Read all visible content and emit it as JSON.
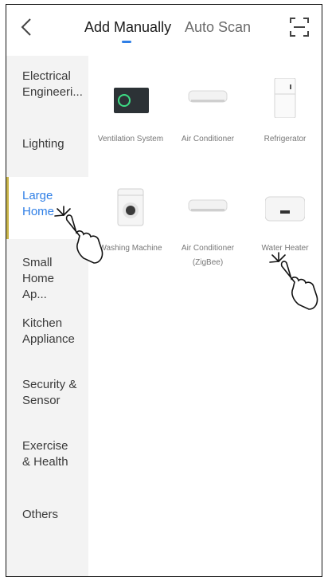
{
  "header": {
    "tabs": [
      {
        "label": "Add Manually",
        "active": true
      },
      {
        "label": "Auto Scan",
        "active": false
      }
    ],
    "back_icon": "chevron-left-icon",
    "scan_icon": "scan-frame-icon",
    "accent_color": "#2f7fe6"
  },
  "sidebar": {
    "items": [
      {
        "label": "Electrical Engineeri..."
      },
      {
        "label": "Lighting"
      },
      {
        "label": "Large Home",
        "active": true
      },
      {
        "label": "Small Home Ap..."
      },
      {
        "label": "Kitchen Appliance"
      },
      {
        "label": "Security & Sensor"
      },
      {
        "label": "Exercise & Health"
      },
      {
        "label": "Others"
      }
    ]
  },
  "devices": [
    {
      "name": "Ventilation System",
      "icon": "ventilation-icon"
    },
    {
      "name": "Air Conditioner",
      "icon": "air-conditioner-icon"
    },
    {
      "name": "Refrigerator",
      "icon": "refrigerator-icon"
    },
    {
      "name": "Washing Machine",
      "icon": "washing-machine-icon"
    },
    {
      "name": "Air Conditioner (ZigBee)",
      "icon": "air-conditioner-zigbee-icon"
    },
    {
      "name": "Water Heater",
      "icon": "water-heater-icon"
    }
  ]
}
